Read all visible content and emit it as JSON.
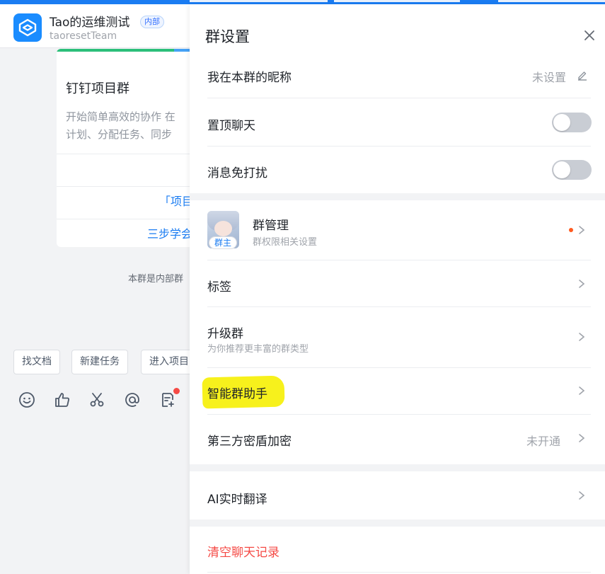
{
  "chat": {
    "group_name": "Tao的运维测试",
    "internal_badge": "内部",
    "team_name": "taoresetTeam",
    "card": {
      "title": "钉钉项目群",
      "desc_line1": "开始简单高效的协作 在",
      "desc_line2": "计划、分配任务、同步",
      "link1": "「项目",
      "link2": "三步学会"
    },
    "notice": "本群是内部群",
    "quick_buttons": [
      "找文档",
      "新建任务",
      "进入项目"
    ],
    "toolbar_icons": [
      "emoji-icon",
      "thumbs-up-icon",
      "scissors-icon",
      "at-icon",
      "note-add-icon"
    ]
  },
  "panel": {
    "title": "群设置",
    "nickname": {
      "label": "我在本群的昵称",
      "value": "未设置"
    },
    "pin_chat": {
      "label": "置顶聊天",
      "on": false
    },
    "mute": {
      "label": "消息免打扰",
      "on": false
    },
    "group_manage": {
      "label": "群管理",
      "sub": "群权限相关设置",
      "owner_badge": "群主"
    },
    "tags": {
      "label": "标签"
    },
    "upgrade": {
      "label": "升级群",
      "sub": "为你推荐更丰富的群类型"
    },
    "assistant": {
      "label": "智能群助手"
    },
    "encryption": {
      "label": "第三方密盾加密",
      "value": "未开通"
    },
    "translate": {
      "label": "AI实时翻译"
    },
    "clear_history": {
      "label": "清空聊天记录"
    }
  },
  "colors": {
    "accent": "#1a7cf2",
    "danger": "#f54a45",
    "highlight": "#f7f11c",
    "notify_dot": "#ff5a1f"
  }
}
